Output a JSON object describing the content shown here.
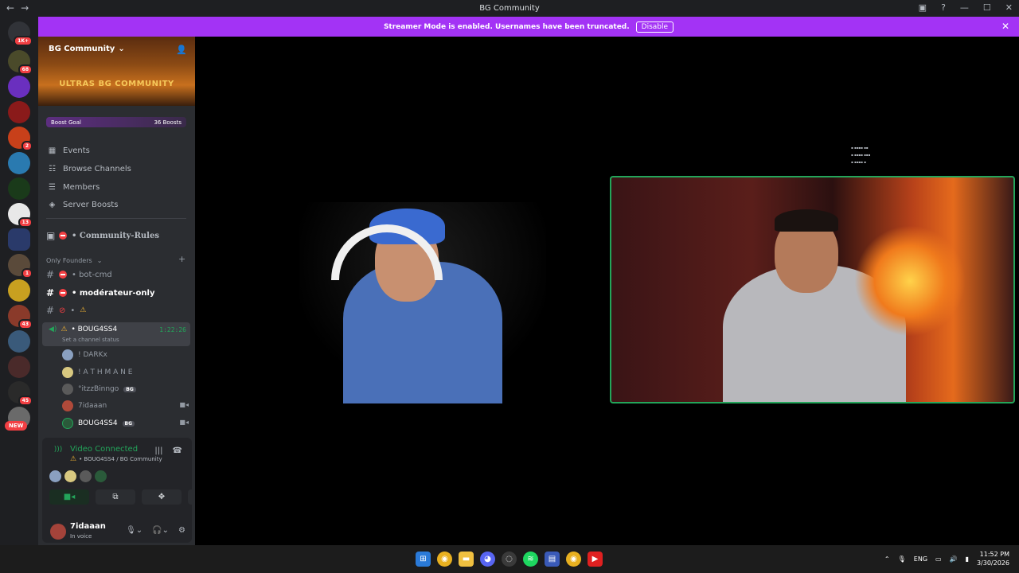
{
  "window": {
    "title": "BG Community",
    "back": "←",
    "forward": "→",
    "controls": {
      "inbox": "▣",
      "help": "?",
      "minimize": "—",
      "maximize": "☐",
      "close": "✕"
    }
  },
  "banner": {
    "text": "Streamer Mode is enabled. Usernames have been truncated.",
    "button": "Disable",
    "close": "✕"
  },
  "rail": {
    "badges": [
      "1K+",
      "68",
      "2",
      "13",
      "1",
      "43",
      "45"
    ],
    "new_label": "NEW"
  },
  "guild": {
    "name": "BG Community",
    "banner_text": "ULTRAS BG COMMUNITY",
    "boost_goal": "Boost Goal",
    "boost_count": "36 Boosts"
  },
  "nav": [
    {
      "label": "Events",
      "icon": "calendar-icon"
    },
    {
      "label": "Browse Channels",
      "icon": "grid-icon"
    },
    {
      "label": "Members",
      "icon": "members-icon"
    },
    {
      "label": "Server Boosts",
      "icon": "boost-icon"
    }
  ],
  "channels": {
    "rules": "• Community-Rules",
    "category": "Only Founders",
    "bot": "• bot-cmd",
    "mod": "• modérateur-only",
    "third": "•"
  },
  "voice": {
    "channel": "• BOUG4SS4",
    "time": "1:22:26",
    "status": "Set a channel status",
    "users": [
      {
        "name": "! DARKx",
        "tag": "",
        "cam": false
      },
      {
        "name": "! A T H M A N E",
        "tag": "",
        "cam": false
      },
      {
        "name": "°itzzBinngo",
        "tag": "BG",
        "cam": false
      },
      {
        "name": "7idaaan",
        "tag": "",
        "cam": true
      },
      {
        "name": "BOUG4SS4",
        "tag": "BG",
        "cam": true
      }
    ]
  },
  "panel": {
    "connected": "Video Connected",
    "location": "• BOUG4SS4 / BG Community"
  },
  "user": {
    "name": "7idaaan",
    "status": "In voice"
  },
  "taskbar": {
    "lang": "ENG",
    "time": "11:52 PM",
    "date": "3/30/2026"
  },
  "colors": {
    "accent": "#a333f5",
    "online": "#23a55a",
    "danger": "#f23f43"
  }
}
